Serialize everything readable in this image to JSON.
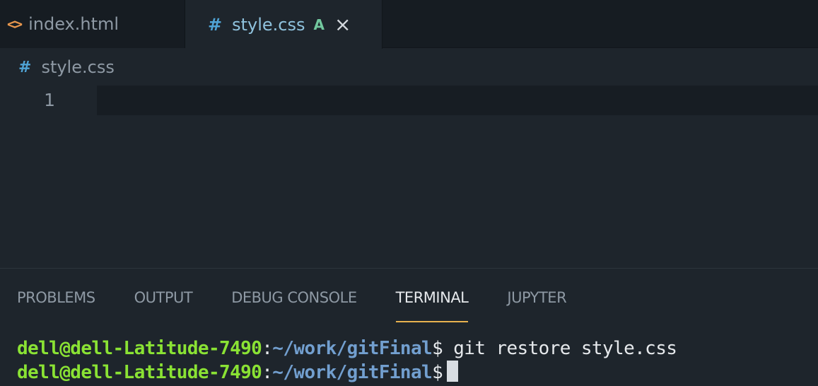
{
  "editor_tabs": [
    {
      "label": "index.html",
      "icon": "html-file-icon",
      "active": false
    },
    {
      "label": "style.css",
      "icon": "css-file-icon",
      "active": true,
      "git_status": "A",
      "close_symbol": "×"
    }
  ],
  "breadcrumb": {
    "icon": "#",
    "label": "style.css"
  },
  "html_icon_glyph": "<>",
  "css_icon_glyph": "#",
  "editor": {
    "line_numbers": [
      "1"
    ]
  },
  "panel": {
    "tabs": [
      "PROBLEMS",
      "OUTPUT",
      "DEBUG CONSOLE",
      "TERMINAL",
      "JUPYTER"
    ],
    "active_tab": "TERMINAL"
  },
  "terminal": {
    "lines": [
      {
        "user": "dell@dell-Latitude-7490",
        "colon": ":",
        "path": "~/work/gitFinal",
        "dollar": "$",
        "command": " git restore style.css"
      },
      {
        "user": "dell@dell-Latitude-7490",
        "colon": ":",
        "path": "~/work/gitFinal",
        "dollar": "$",
        "command": " "
      }
    ]
  },
  "colors": {
    "editor_bg": "#1e252c",
    "tabbar_bg": "#161c22",
    "accent": "#e8b24f",
    "prompt_user": "#8ae234",
    "prompt_path": "#729fcf",
    "git_added": "#72c89e"
  }
}
